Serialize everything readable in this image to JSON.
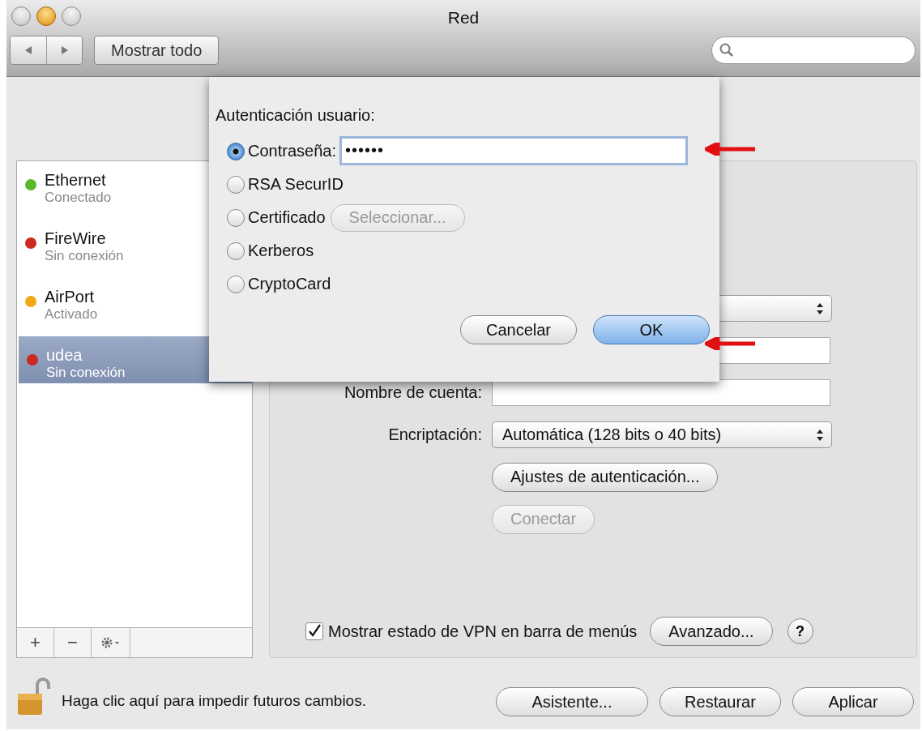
{
  "window": {
    "title": "Red",
    "show_all": "Mostrar todo"
  },
  "services": [
    {
      "name": "Ethernet",
      "status": "Conectado",
      "color": "#5cb82c",
      "selected": false
    },
    {
      "name": "FireWire",
      "status": "Sin conexión",
      "color": "#cc2a1e",
      "selected": false
    },
    {
      "name": "AirPort",
      "status": "Activado",
      "color": "#f0a818",
      "selected": false
    },
    {
      "name": "udea",
      "status": "Sin conexión",
      "color": "#cc2a1e",
      "selected": true
    }
  ],
  "list_toolbar": {
    "add": "+",
    "remove": "−"
  },
  "form": {
    "rows": [
      {
        "kind": "field",
        "label": "Nombre de cuenta:",
        "value": ""
      },
      {
        "kind": "popup",
        "label": "Encriptación:",
        "value": "Automática (128 bits o 40 bits)"
      }
    ],
    "buttons": [
      {
        "label": "Ajustes de autenticación...",
        "disabled": false
      },
      {
        "label": "Conectar",
        "disabled": true
      }
    ],
    "show_vpn": {
      "label": "Mostrar estado de VPN en barra de menús",
      "checked": true
    },
    "advanced": "Avanzado...",
    "help": "?"
  },
  "footer": {
    "lock_text": "Haga clic aquí para impedir futuros cambios.",
    "buttons": [
      "Asistente...",
      "Restaurar",
      "Aplicar"
    ]
  },
  "dialog": {
    "title": "Autenticación usuario:",
    "options": [
      {
        "kind": "password",
        "label": "Contraseña:",
        "selected": true,
        "password": "••••••"
      },
      {
        "kind": "plain",
        "label": "RSA SecurID",
        "selected": false
      },
      {
        "kind": "certificate",
        "label": "Certificado",
        "button": "Seleccionar...",
        "selected": false
      },
      {
        "kind": "plain",
        "label": "Kerberos",
        "selected": false
      },
      {
        "kind": "plain",
        "label": "CryptoCard",
        "selected": false
      }
    ],
    "buttons": [
      {
        "label": "Cancelar",
        "default": false
      },
      {
        "label": "OK",
        "default": true
      }
    ]
  }
}
